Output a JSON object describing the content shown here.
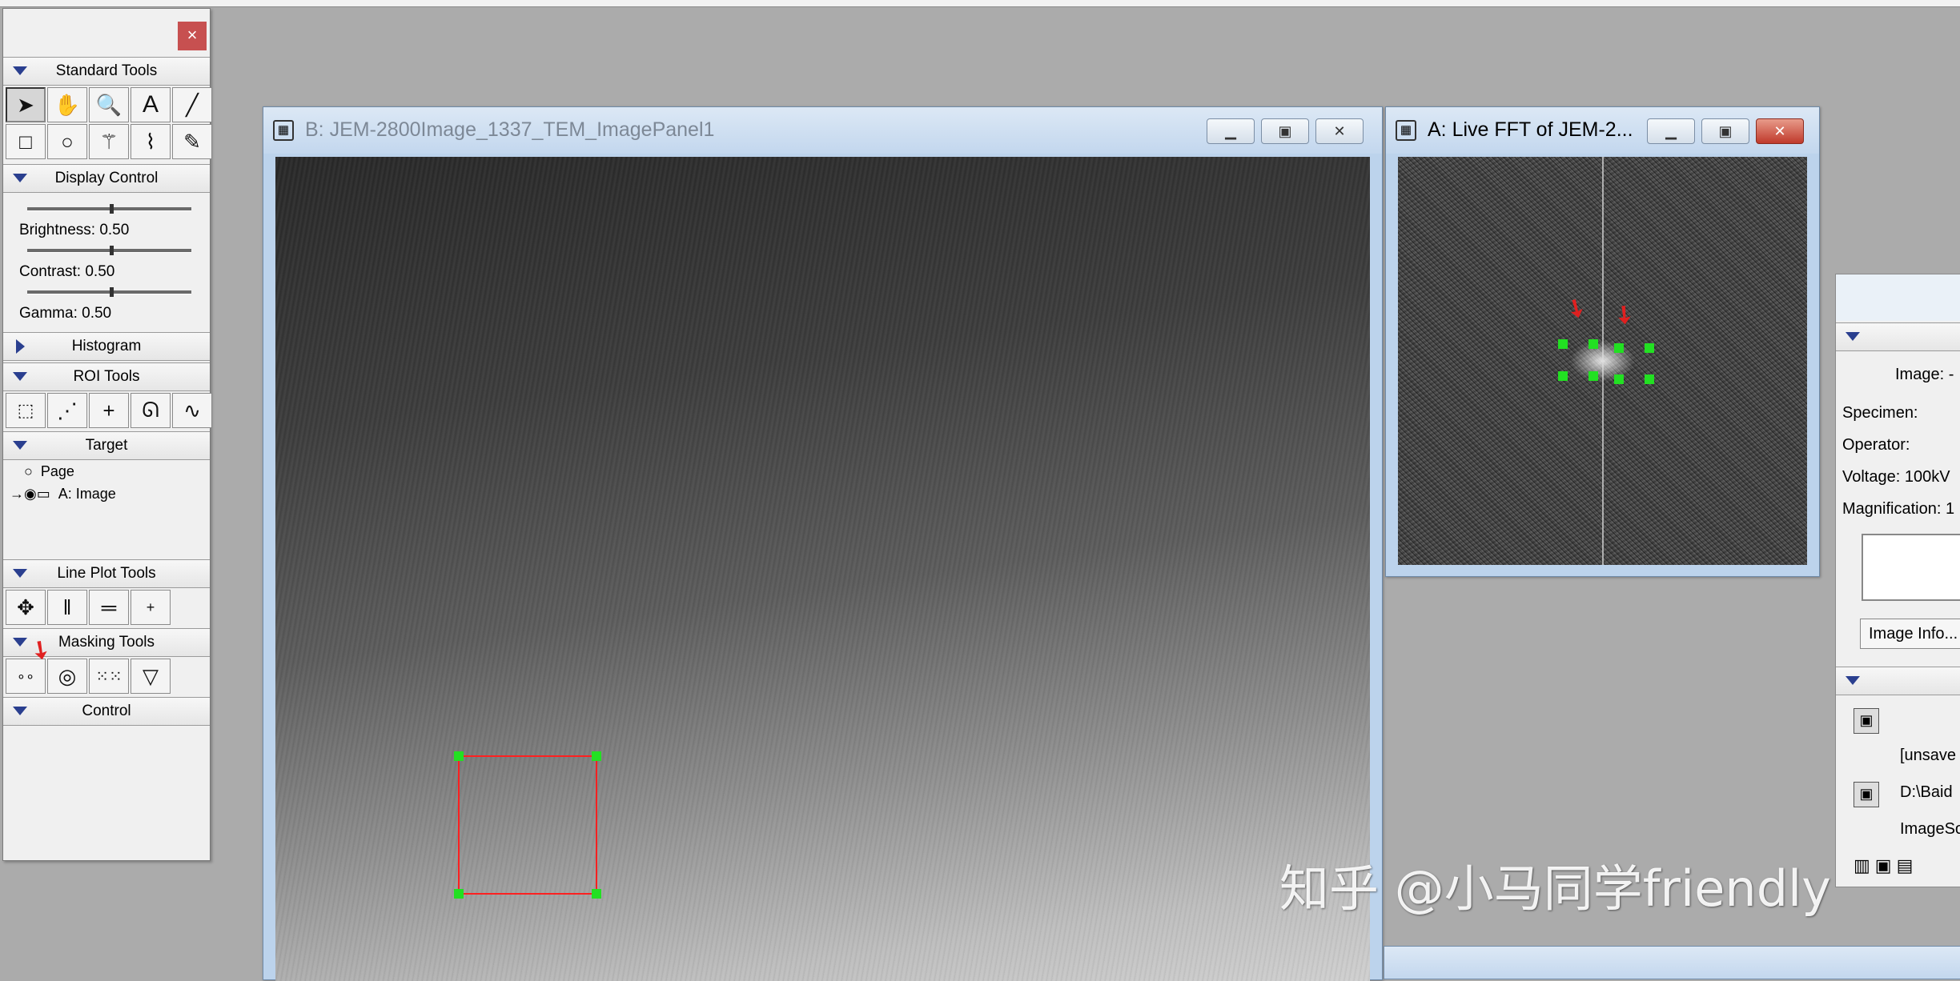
{
  "palette": {
    "close": "×",
    "sections": {
      "standard_tools": "Standard Tools",
      "display_control": "Display Control",
      "histogram": "Histogram",
      "roi_tools": "ROI Tools",
      "target": "Target",
      "line_plot_tools": "Line Plot Tools",
      "masking_tools": "Masking Tools",
      "control": "Control"
    },
    "brightness": "Brightness: 0.50",
    "contrast": "Contrast: 0.50",
    "gamma": "Gamma: 0.50",
    "target_items": [
      "Page",
      "A: Image"
    ]
  },
  "window_b": {
    "title": "B: JEM-2800Image_1337_TEM_ImagePanel1"
  },
  "window_a": {
    "title": "A: Live FFT of JEM-2..."
  },
  "info_panel": {
    "image": "Image: -",
    "specimen": "Specimen:",
    "operator": "Operator:",
    "voltage": "Voltage: 100kV",
    "magnification": "Magnification: 1",
    "image_info_button": "Image Info...",
    "unsaved": "[unsave",
    "path": "D:\\Baid",
    "imagesource": "ImageSo"
  },
  "watermark": "知乎 @小马同学friendly"
}
